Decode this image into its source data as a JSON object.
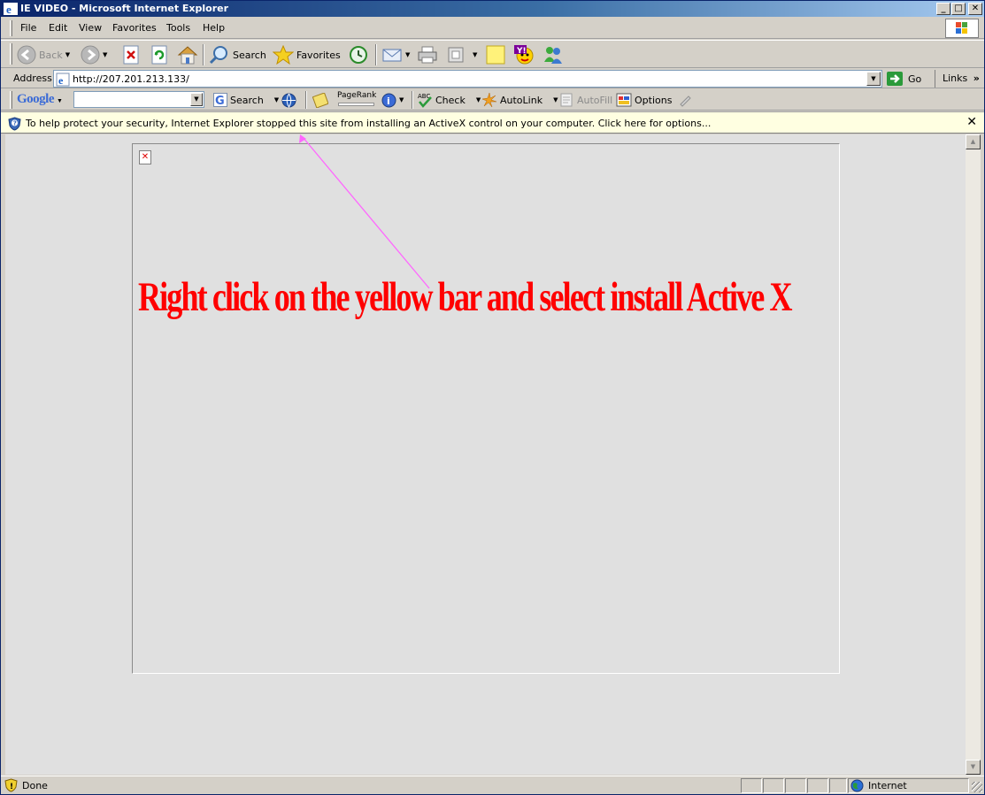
{
  "window": {
    "title": "IE VIDEO - Microsoft Internet Explorer",
    "controls": {
      "minimize": "_",
      "maximize": "□",
      "close": "✕"
    }
  },
  "menu": [
    "File",
    "Edit",
    "View",
    "Favorites",
    "Tools",
    "Help"
  ],
  "toolbar": {
    "back": "Back",
    "search": "Search",
    "favorites": "Favorites"
  },
  "address": {
    "label": "Address",
    "url": "http://207.201.213.133/",
    "go": "Go",
    "links": "Links"
  },
  "google_toolbar": {
    "logo": "Google",
    "search_value": "",
    "search": "Search",
    "pagerank": "PageRank",
    "check": "Check",
    "autolink": "AutoLink",
    "autofill": "AutoFill",
    "options": "Options"
  },
  "infobar": {
    "message": "To help protect your security, Internet Explorer stopped this site from installing an ActiveX control on your computer. Click here for options...",
    "close": "✕"
  },
  "page": {
    "instruction": "Right click on the yellow bar and select install Active X",
    "instruction_color": "#ff0000",
    "arrow_color": "#ff66ff"
  },
  "status": {
    "text": "Done",
    "zone": "Internet"
  },
  "icons": [
    "ie-icon",
    "windows-logo-icon",
    "back-icon",
    "forward-icon",
    "stop-icon",
    "refresh-icon",
    "home-icon",
    "search-icon",
    "favorites-icon",
    "history-icon",
    "mail-icon",
    "print-icon",
    "edit-icon",
    "notes-icon",
    "yahoo-icon",
    "messenger-icon",
    "page-icon",
    "go-arrow-icon",
    "google-search-icon",
    "globe-icon",
    "pagerank-icon",
    "info-icon",
    "spellcheck-icon",
    "autolink-icon",
    "autofill-icon",
    "options-icon",
    "highlight-icon",
    "shield-icon",
    "broken-image-icon",
    "warning-shield-icon",
    "internet-globe-icon"
  ]
}
